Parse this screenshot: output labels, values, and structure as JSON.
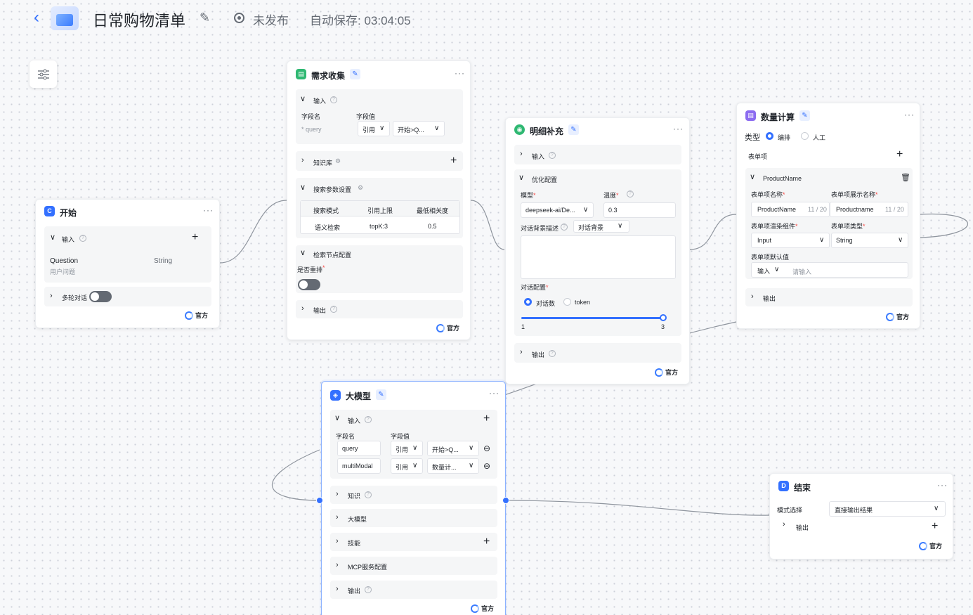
{
  "header": {
    "back_icon": "‹",
    "title": "日常购物清单",
    "status": "未发布",
    "autosave": "自动保存: 03:04:05"
  },
  "common": {
    "official": "官方",
    "more": "···",
    "input": "输入",
    "output": "输出",
    "field_name": "字段名",
    "field_value": "字段值",
    "ref": "引用"
  },
  "start": {
    "title": "开始",
    "field": "Question",
    "type": "String",
    "desc": "用户问题",
    "multi_turn": "多轮对话"
  },
  "collect": {
    "title": "需求收集",
    "query_label": "* query",
    "ref_value": "开始>Q...",
    "knowledge": "知识库",
    "search_settings": "搜索参数设置",
    "table_headers": [
      "搜索模式",
      "引用上限",
      "最低相关度"
    ],
    "table_row": [
      "语义检索",
      "topK:3",
      "0.5"
    ],
    "node_config": "检索节点配置",
    "rerank": "是否重排"
  },
  "detail": {
    "title": "明细补充",
    "optimize": "优化配置",
    "model_label": "模型",
    "temp_label": "温度",
    "model_value": "deepseek-ai/De...",
    "temp_value": "0.3",
    "bg_desc": "对话背景描述",
    "bg_select": "对话背景",
    "dialog_config": "对话配置",
    "opt_count": "对话数",
    "opt_token": "token",
    "slider_min": "1",
    "slider_max": "3",
    "slider_value": 3
  },
  "calc": {
    "title": "数量计算",
    "type_label": "类型",
    "type_opt1": "编排",
    "type_opt2": "人工",
    "form_items": "表单项",
    "item_name": "ProductName",
    "item_name_label": "表单项名称",
    "item_display_label": "表单项展示名称",
    "item_name_value": "ProductName",
    "item_name_count": "11 / 20",
    "item_display_value": "Productname",
    "item_display_count": "11 / 20",
    "render_label": "表单项渲染组件",
    "type_field_label": "表单项类型",
    "render_value": "Input",
    "type_value": "String",
    "default_label": "表单项默认值",
    "default_mode": "输入",
    "default_placeholder": "请输入"
  },
  "llm": {
    "title": "大模型",
    "row1_name": "query",
    "row1_ref": "开始>Q...",
    "row2_name": "multiModal",
    "row2_ref": "数量计...",
    "knowledge": "知识",
    "model": "大模型",
    "skills": "技能",
    "mcp": "MCP服务配置"
  },
  "end": {
    "title": "结束",
    "mode_label": "模式选择",
    "mode_value": "直接输出结果"
  }
}
